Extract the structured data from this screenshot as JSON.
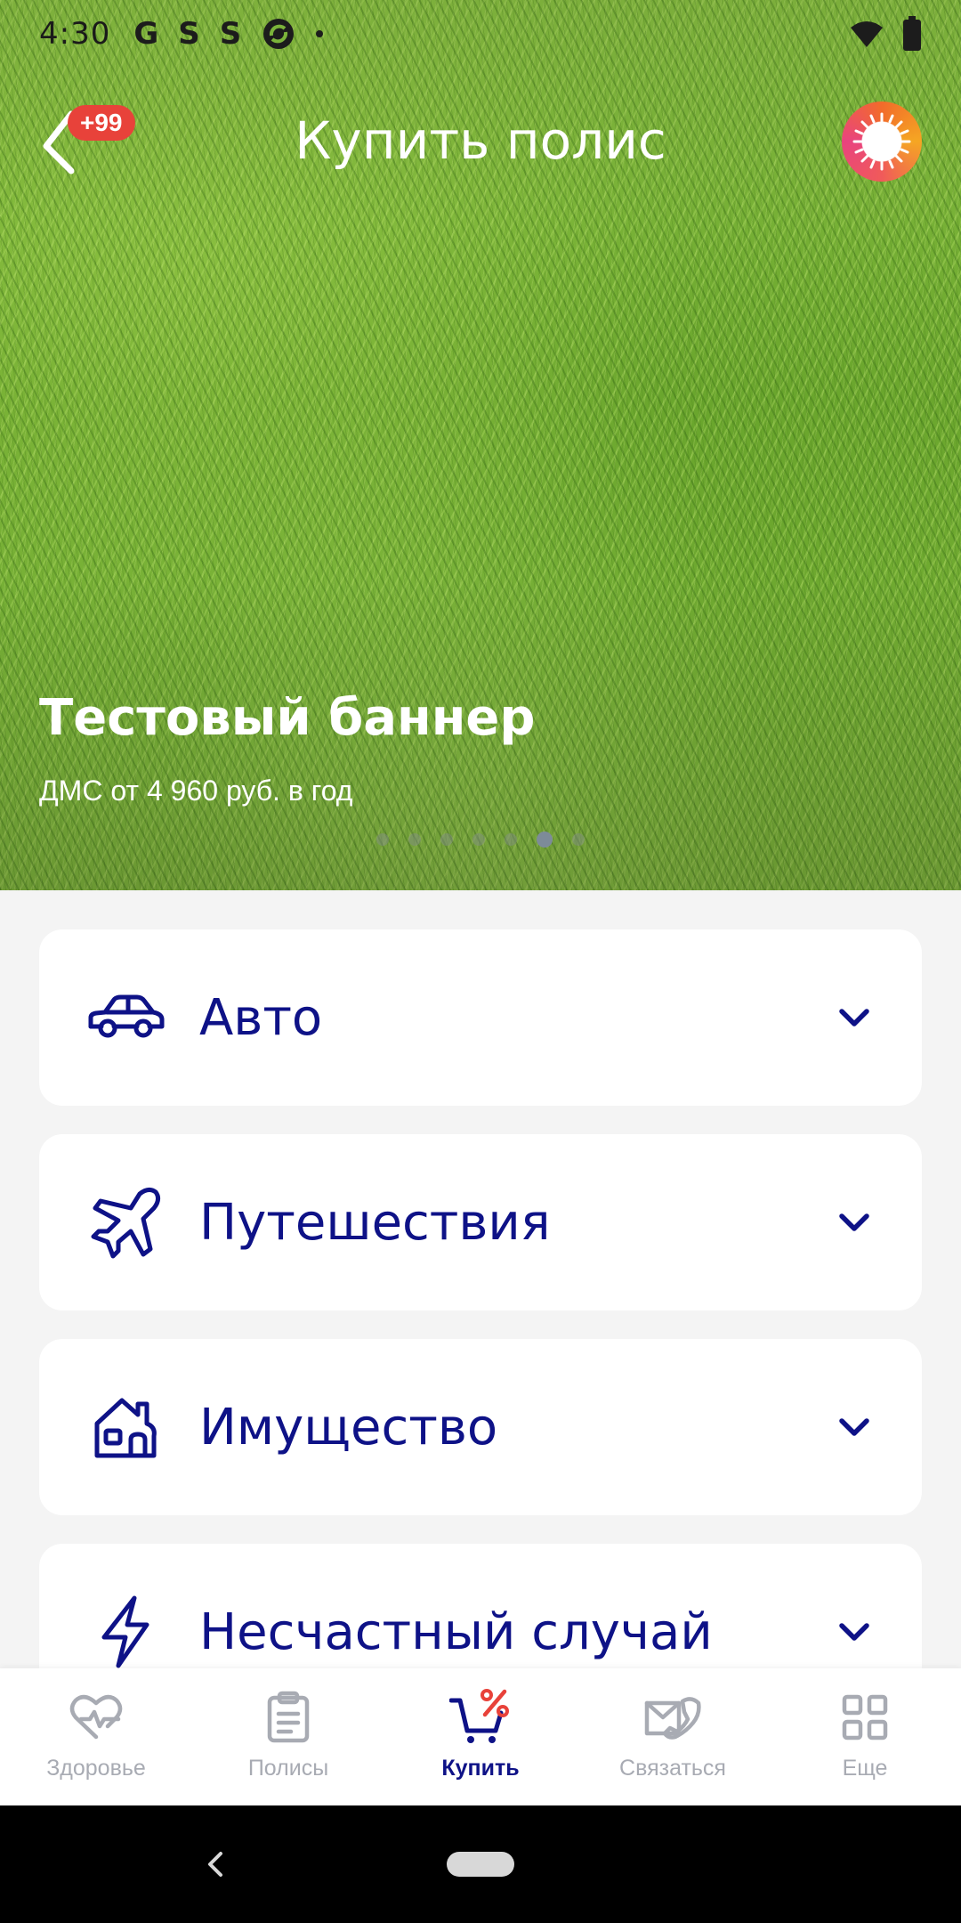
{
  "status_bar": {
    "time": "4:30",
    "left_icons": [
      "G",
      "S",
      "S"
    ],
    "right_icons": [
      "wifi-icon",
      "battery-icon"
    ]
  },
  "header": {
    "title": "Купить полис",
    "badge": "+99",
    "back_icon": "chevron-left-icon",
    "avatar_icon": "spinner-ring-icon"
  },
  "banner": {
    "title": "Тестовый баннер",
    "subtitle": "ДМС от 4 960 руб. в год",
    "dots_total": 7,
    "dots_active_index": 5
  },
  "categories": [
    {
      "label": "Авто",
      "icon": "car-icon"
    },
    {
      "label": "Путешествия",
      "icon": "airplane-icon"
    },
    {
      "label": "Имущество",
      "icon": "house-icon"
    },
    {
      "label": "Несчастный случай",
      "icon": "lightning-icon"
    }
  ],
  "bottom_nav": {
    "items": [
      {
        "label": "Здоровье",
        "icon": "heart-pulse-icon",
        "active": false
      },
      {
        "label": "Полисы",
        "icon": "clipboard-icon",
        "active": false
      },
      {
        "label": "Купить",
        "icon": "cart-percent-icon",
        "active": true
      },
      {
        "label": "Связаться",
        "icon": "envelope-phone-icon",
        "active": false
      },
      {
        "label": "Еще",
        "icon": "grid-icon",
        "active": false
      }
    ]
  },
  "colors": {
    "primary": "#0e1287",
    "badge": "#e8423a",
    "inactive": "#a8abb3",
    "accent_orange": "#f26b2a"
  }
}
